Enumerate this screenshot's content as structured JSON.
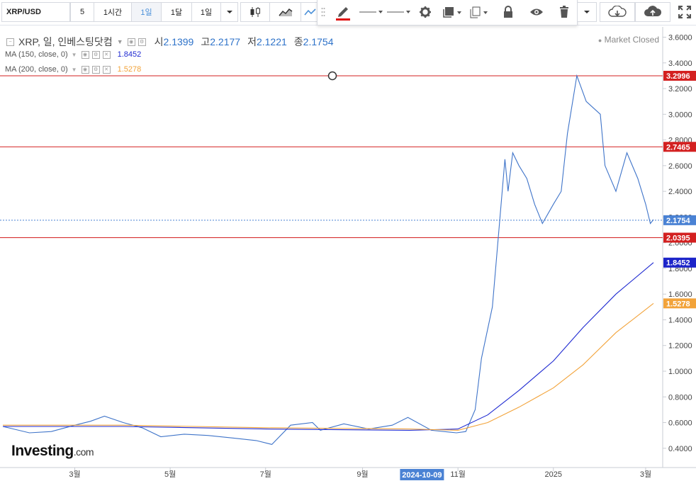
{
  "toolbar": {
    "symbol": "XRP/USD",
    "intervals": [
      "5",
      "1시간",
      "1일",
      "1달",
      "1일"
    ],
    "active_interval_index": 2
  },
  "legend": {
    "title": "XRP, 일, 인베스팅닷컴",
    "open_label": "시",
    "open": "2.1399",
    "high_label": "고",
    "high": "2.2177",
    "low_label": "저",
    "low": "2.1221",
    "close_label": "종",
    "close": "2.1754",
    "ma150_label": "MA (150, close, 0)",
    "ma150_value": "1.8452",
    "ma200_label": "MA (200, close, 0)",
    "ma200_value": "1.5278",
    "market_status": "Market Closed"
  },
  "branding": {
    "name": "Investing",
    "suffix": ".com"
  },
  "colors": {
    "price_line": "#3f74c9",
    "ma150": "#1f2ad1",
    "ma200": "#f2a33a",
    "hline": "#d32020",
    "last_price_label": "#4a82d4",
    "ma150_label": "#1c24c9",
    "ma200_label": "#f2a33a",
    "date_highlight": "#4a82d4"
  },
  "chart_data": {
    "type": "line",
    "y_ticks": [
      "3.6000",
      "3.4000",
      "3.2000",
      "3.0000",
      "2.8000",
      "2.6000",
      "2.4000",
      "2.2000",
      "2.0000",
      "1.8000",
      "1.6000",
      "1.4000",
      "1.2000",
      "1.0000",
      "0.8000",
      "0.6000",
      "0.4000"
    ],
    "ylim": [
      0.25,
      3.68
    ],
    "x_ticks": [
      "3월",
      "5월",
      "7월",
      "9월",
      "11월",
      "2025",
      "3월"
    ],
    "highlighted_date": "2024-10-09",
    "horizontal_lines": [
      {
        "value": 3.2996,
        "label": "3.2996"
      },
      {
        "value": 2.7465,
        "label": "2.7465"
      },
      {
        "value": 2.0395,
        "label": "2.0395"
      }
    ],
    "last_price": {
      "value": 2.1754,
      "label": "2.1754"
    },
    "series": [
      {
        "name": "XRP",
        "x": [
          "2024-01-15",
          "2024-02-01",
          "2024-02-15",
          "2024-03-01",
          "2024-03-11",
          "2024-03-20",
          "2024-04-01",
          "2024-04-13",
          "2024-04-25",
          "2024-05-10",
          "2024-05-25",
          "2024-06-10",
          "2024-06-25",
          "2024-07-05",
          "2024-07-17",
          "2024-07-31",
          "2024-08-05",
          "2024-08-20",
          "2024-09-05",
          "2024-09-20",
          "2024-09-30",
          "2024-10-15",
          "2024-10-31",
          "2024-11-06",
          "2024-11-12",
          "2024-11-16",
          "2024-11-23",
          "2024-12-01",
          "2024-12-03",
          "2024-12-06",
          "2024-12-10",
          "2024-12-15",
          "2024-12-20",
          "2024-12-25",
          "2025-01-01",
          "2025-01-06",
          "2025-01-10",
          "2025-01-16",
          "2025-01-22",
          "2025-01-31",
          "2025-02-03",
          "2025-02-10",
          "2025-02-17",
          "2025-02-24",
          "2025-03-01",
          "2025-03-04",
          "2025-03-06"
        ],
        "values": [
          0.57,
          0.52,
          0.53,
          0.58,
          0.61,
          0.65,
          0.6,
          0.56,
          0.49,
          0.51,
          0.5,
          0.48,
          0.46,
          0.43,
          0.58,
          0.6,
          0.54,
          0.59,
          0.55,
          0.58,
          0.64,
          0.54,
          0.52,
          0.53,
          0.7,
          1.1,
          1.5,
          2.65,
          2.4,
          2.7,
          2.6,
          2.5,
          2.3,
          2.15,
          2.3,
          2.4,
          2.85,
          3.3,
          3.1,
          3.0,
          2.6,
          2.4,
          2.7,
          2.5,
          2.3,
          2.15,
          2.18
        ]
      },
      {
        "name": "MA (150, close, 0)",
        "x": [
          "2024-01-15",
          "2024-04-01",
          "2024-07-01",
          "2024-10-01",
          "2024-11-01",
          "2024-11-20",
          "2024-12-10",
          "2025-01-01",
          "2025-01-20",
          "2025-02-10",
          "2025-03-06"
        ],
        "values": [
          0.57,
          0.57,
          0.55,
          0.54,
          0.55,
          0.66,
          0.85,
          1.08,
          1.34,
          1.6,
          1.8452
        ]
      },
      {
        "name": "MA (200, close, 0)",
        "x": [
          "2024-01-15",
          "2024-04-01",
          "2024-07-01",
          "2024-10-01",
          "2024-11-01",
          "2024-11-20",
          "2024-12-10",
          "2025-01-01",
          "2025-01-20",
          "2025-02-10",
          "2025-03-06"
        ],
        "values": [
          0.58,
          0.58,
          0.56,
          0.55,
          0.54,
          0.6,
          0.72,
          0.87,
          1.05,
          1.3,
          1.5278
        ]
      }
    ]
  }
}
